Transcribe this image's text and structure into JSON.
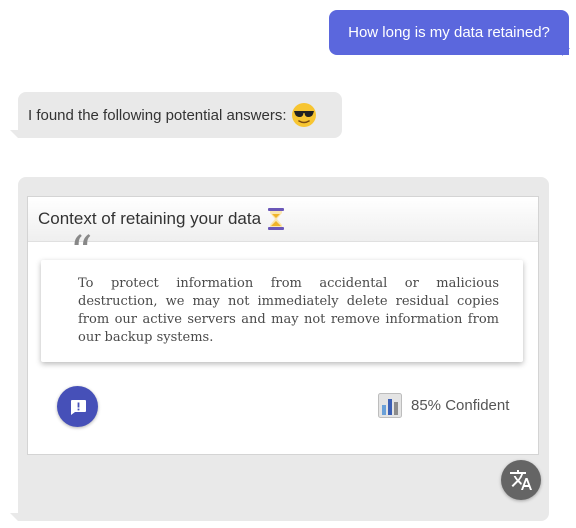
{
  "user_message": {
    "text": "How long is my data retained?"
  },
  "bot_message": {
    "text": "I found the following potential answers:",
    "emoji": "sunglasses-face-icon"
  },
  "answer_card": {
    "title": "Context of retaining your data",
    "title_icon": "hourglass-icon",
    "quote_text": "To protect information from accidental or malicious destruction, we may not immediately delete residual copies from our active servers and may not remove information from our backup systems.",
    "feedback_icon": "feedback-icon",
    "confidence_icon": "bar-chart-icon",
    "confidence_text": "85% Confident"
  },
  "translate_button": {
    "icon": "translate-icon"
  },
  "colors": {
    "user_bubble": "#5b67dd",
    "bot_bubble": "#e9e9e9",
    "feedback_button": "#4650b8",
    "translate_button": "#656565"
  }
}
